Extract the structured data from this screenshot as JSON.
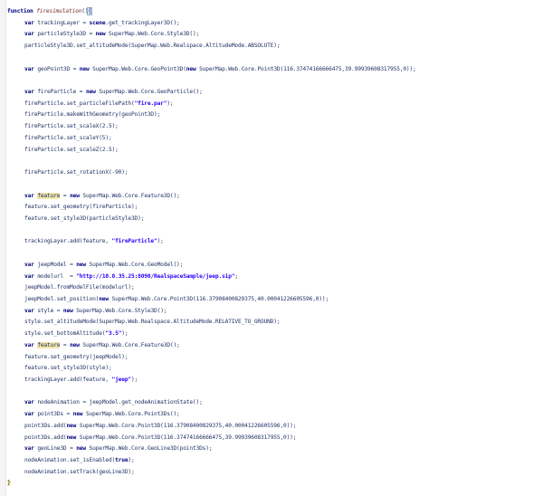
{
  "code": {
    "lines": [
      {
        "indent": 0,
        "tokens": [
          {
            "t": "kw",
            "v": "function "
          },
          {
            "t": "fn",
            "v": "firesimulation"
          },
          {
            "t": "plain",
            "v": "()"
          },
          {
            "t": "cursor",
            "v": "{"
          }
        ]
      },
      {
        "indent": 1,
        "tokens": [
          {
            "t": "kw",
            "v": "var "
          },
          {
            "t": "plain",
            "v": "trackingLayer = "
          },
          {
            "t": "kw",
            "v": "scene"
          },
          {
            "t": "plain",
            "v": ".get_trackingLayer3D();"
          }
        ]
      },
      {
        "indent": 1,
        "tokens": [
          {
            "t": "kw",
            "v": "var "
          },
          {
            "t": "plain",
            "v": "particleStyle3D = "
          },
          {
            "t": "kw",
            "v": "new "
          },
          {
            "t": "plain",
            "v": "SuperMap.Web.Core.Style3D();"
          }
        ]
      },
      {
        "indent": 1,
        "tokens": [
          {
            "t": "plain",
            "v": "particleStyle3D.set_altitudeMode(SuperMap.Web.Realspace.AltitudeMode.ABSOLUTE);"
          }
        ]
      },
      {
        "indent": 1,
        "tokens": []
      },
      {
        "indent": 1,
        "tokens": [
          {
            "t": "kw",
            "v": "var "
          },
          {
            "t": "plain",
            "v": "geoPoint3D = "
          },
          {
            "t": "kw",
            "v": "new "
          },
          {
            "t": "plain",
            "v": "SuperMap.Web.Core.GeoPoint3D("
          },
          {
            "t": "kw",
            "v": "new "
          },
          {
            "t": "plain",
            "v": "SuperMap.Web.Core.Point3D(116.37474166666475,39.99939608317955,0));"
          }
        ]
      },
      {
        "indent": 1,
        "tokens": []
      },
      {
        "indent": 1,
        "tokens": [
          {
            "t": "kw",
            "v": "var "
          },
          {
            "t": "plain",
            "v": "fireParticle = "
          },
          {
            "t": "kw",
            "v": "new "
          },
          {
            "t": "plain",
            "v": "SuperMap.Web.Core.GeoParticle();"
          }
        ]
      },
      {
        "indent": 1,
        "tokens": [
          {
            "t": "plain",
            "v": "fireParticle.set_particleFilePath("
          },
          {
            "t": "str",
            "v": "\"fire.par\""
          },
          {
            "t": "plain",
            "v": ");"
          }
        ]
      },
      {
        "indent": 1,
        "tokens": [
          {
            "t": "plain",
            "v": "fireParticle.makeWithGeometry(geoPoint3D);"
          }
        ]
      },
      {
        "indent": 1,
        "tokens": [
          {
            "t": "plain",
            "v": "fireParticle.set_scaleX(2.5);"
          }
        ]
      },
      {
        "indent": 1,
        "tokens": [
          {
            "t": "plain",
            "v": "fireParticle.set_scaleY(5);"
          }
        ]
      },
      {
        "indent": 1,
        "tokens": [
          {
            "t": "plain",
            "v": "fireParticle.set_scaleZ(2.5);"
          }
        ]
      },
      {
        "indent": 1,
        "tokens": []
      },
      {
        "indent": 1,
        "tokens": [
          {
            "t": "plain",
            "v": "fireParticle.set_rotationX(-90);"
          }
        ]
      },
      {
        "indent": 1,
        "tokens": []
      },
      {
        "indent": 1,
        "tokens": [
          {
            "t": "kw",
            "v": "var "
          },
          {
            "t": "hl",
            "v": "feature"
          },
          {
            "t": "plain",
            "v": " = "
          },
          {
            "t": "kw",
            "v": "new "
          },
          {
            "t": "plain",
            "v": "SuperMap.Web.Core.Feature3D();"
          }
        ]
      },
      {
        "indent": 1,
        "tokens": [
          {
            "t": "plain",
            "v": "feature.set_geometry(fireParticle);"
          }
        ]
      },
      {
        "indent": 1,
        "tokens": [
          {
            "t": "plain",
            "v": "feature.set_style3D(particleStyle3D);"
          }
        ]
      },
      {
        "indent": 1,
        "tokens": []
      },
      {
        "indent": 1,
        "tokens": [
          {
            "t": "plain",
            "v": "trackingLayer.add(feature, "
          },
          {
            "t": "str",
            "v": "\"fireParticle\""
          },
          {
            "t": "plain",
            "v": ");"
          }
        ]
      },
      {
        "indent": 1,
        "tokens": []
      },
      {
        "indent": 1,
        "tokens": [
          {
            "t": "kw",
            "v": "var "
          },
          {
            "t": "plain",
            "v": "jeepModel = "
          },
          {
            "t": "kw",
            "v": "new "
          },
          {
            "t": "plain",
            "v": "SuperMap.Web.Core.GeoModel();"
          }
        ]
      },
      {
        "indent": 1,
        "tokens": [
          {
            "t": "kw",
            "v": "var "
          },
          {
            "t": "plain",
            "v": "modelurl  = "
          },
          {
            "t": "str",
            "v": "\"http://10.0.35.25:8090/RealspaceSample/jeep.sip\""
          },
          {
            "t": "plain",
            "v": ";"
          }
        ]
      },
      {
        "indent": 1,
        "tokens": [
          {
            "t": "plain",
            "v": "jeepModel.fromModelFile(modelurl);"
          }
        ]
      },
      {
        "indent": 1,
        "tokens": [
          {
            "t": "plain",
            "v": "jeepModel.set_position("
          },
          {
            "t": "kw",
            "v": "new "
          },
          {
            "t": "plain",
            "v": "SuperMap.Web.Core.Point3D(116.37908400829375,40.00041226605596,0));"
          }
        ]
      },
      {
        "indent": 1,
        "tokens": [
          {
            "t": "kw",
            "v": "var "
          },
          {
            "t": "plain",
            "v": "style = "
          },
          {
            "t": "kw",
            "v": "new "
          },
          {
            "t": "plain",
            "v": "SuperMap.Web.Core.Style3D();"
          }
        ]
      },
      {
        "indent": 1,
        "tokens": [
          {
            "t": "plain",
            "v": "style.set_altitudeMode(SuperMap.Web.Realspace.AltitudeMode.RELATIVE_TO_GROUND);"
          }
        ]
      },
      {
        "indent": 1,
        "tokens": [
          {
            "t": "plain",
            "v": "style.set_bottomAltitude("
          },
          {
            "t": "str",
            "v": "\"3.5\""
          },
          {
            "t": "plain",
            "v": ");"
          }
        ]
      },
      {
        "indent": 1,
        "tokens": [
          {
            "t": "kw",
            "v": "var "
          },
          {
            "t": "hl",
            "v": "feature"
          },
          {
            "t": "plain",
            "v": " = "
          },
          {
            "t": "kw",
            "v": "new "
          },
          {
            "t": "plain",
            "v": "SuperMap.Web.Core.Feature3D();"
          }
        ]
      },
      {
        "indent": 1,
        "tokens": [
          {
            "t": "plain",
            "v": "feature.set_geometry(jeepModel);"
          }
        ]
      },
      {
        "indent": 1,
        "tokens": [
          {
            "t": "plain",
            "v": "feature.set_style3D(style);"
          }
        ]
      },
      {
        "indent": 1,
        "tokens": [
          {
            "t": "plain",
            "v": "trackingLayer.add(feature, "
          },
          {
            "t": "str",
            "v": "\"jeep\""
          },
          {
            "t": "plain",
            "v": ");"
          }
        ]
      },
      {
        "indent": 1,
        "tokens": []
      },
      {
        "indent": 1,
        "tokens": [
          {
            "t": "kw",
            "v": "var "
          },
          {
            "t": "plain",
            "v": "nodeAnimation = jeepModel.get_nodeAnimationState();"
          }
        ]
      },
      {
        "indent": 1,
        "tokens": [
          {
            "t": "kw",
            "v": "var "
          },
          {
            "t": "plain",
            "v": "point3Ds = "
          },
          {
            "t": "kw",
            "v": "new "
          },
          {
            "t": "plain",
            "v": "SuperMap.Web.Core.Point3Ds();"
          }
        ]
      },
      {
        "indent": 1,
        "tokens": [
          {
            "t": "plain",
            "v": "point3Ds.add("
          },
          {
            "t": "kw",
            "v": "new "
          },
          {
            "t": "plain",
            "v": "SuperMap.Web.Core.Point3D(116.37908400829375,40.00041226605596,0));"
          }
        ]
      },
      {
        "indent": 1,
        "tokens": [
          {
            "t": "plain",
            "v": "point3Ds.add("
          },
          {
            "t": "kw",
            "v": "new "
          },
          {
            "t": "plain",
            "v": "SuperMap.Web.Core.Point3D(116.37474166666475,39.99939608317955,0));"
          }
        ]
      },
      {
        "indent": 1,
        "tokens": [
          {
            "t": "kw",
            "v": "var "
          },
          {
            "t": "plain",
            "v": "geoLine3D = "
          },
          {
            "t": "kw",
            "v": "new "
          },
          {
            "t": "plain",
            "v": "SuperMap.Web.Core.GeoLine3D(point3Ds);"
          }
        ]
      },
      {
        "indent": 1,
        "tokens": [
          {
            "t": "plain",
            "v": "nodeAnimation.set_isEnabled("
          },
          {
            "t": "kw",
            "v": "true"
          },
          {
            "t": "plain",
            "v": ");"
          }
        ]
      },
      {
        "indent": 1,
        "tokens": [
          {
            "t": "plain",
            "v": "nodeAnimation.setTrack(geoLine3D);"
          }
        ]
      },
      {
        "indent": 0,
        "tokens": [
          {
            "t": "endbrace",
            "v": "}"
          }
        ]
      }
    ]
  },
  "colors": {
    "keyword": "#000080",
    "function_name": "#7a2b2b",
    "string": "#2a00ff",
    "text": "#223366",
    "highlight": "#f3e8a8",
    "background": "#ffffff"
  }
}
